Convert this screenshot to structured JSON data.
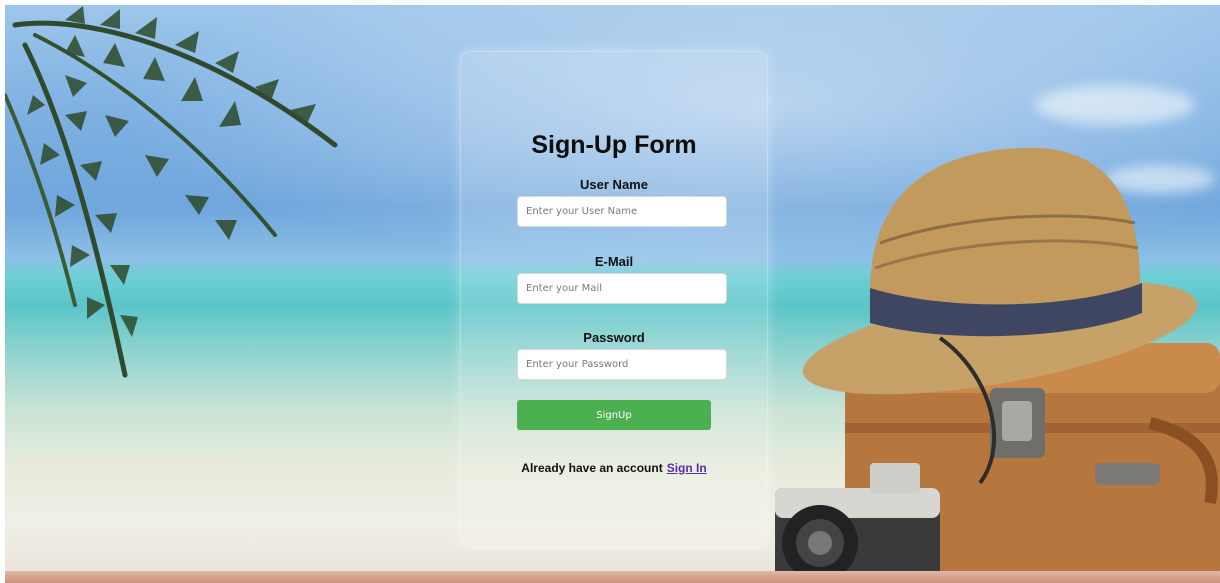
{
  "form": {
    "title": "Sign-Up Form",
    "username": {
      "label": "User Name",
      "placeholder": "Enter your User Name",
      "value": ""
    },
    "email": {
      "label": "E-Mail",
      "placeholder": "Enter your Mail",
      "value": ""
    },
    "password": {
      "label": "Password",
      "placeholder": "Enter your Password",
      "value": ""
    },
    "submit_label": "SignUp",
    "account_prompt": "Already have an account",
    "signin_label": "Sign In"
  },
  "colors": {
    "button": "#4caf50",
    "link": "#5a2ea6"
  }
}
